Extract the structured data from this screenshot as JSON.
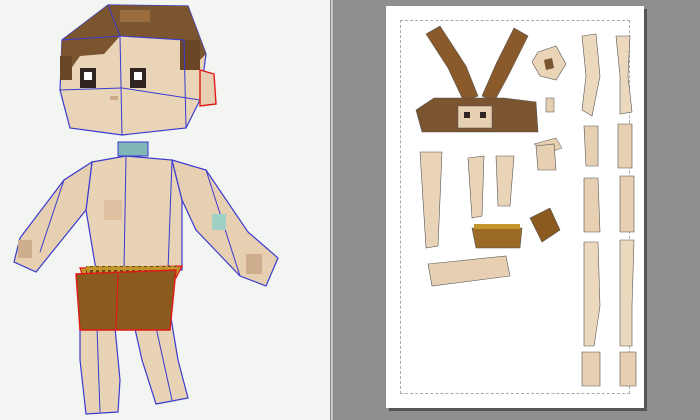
{
  "app": {
    "panes": {
      "left": "3d-model-view",
      "right": "unfolded-sheet-view"
    }
  },
  "colors": {
    "viewport_bg": "#f3f5f2",
    "sheet_area_bg": "#8e8e8e",
    "paper": "#ffffff",
    "skin": "#e7cfb2",
    "skin_shade": "#d8b998",
    "hair": "#7a5530",
    "hair_light": "#9a6c3e",
    "cloth": "#8a5a1e",
    "cloth_band": "#c2962c",
    "wire_blue": "#3a3ad0",
    "wire_red": "#e01818"
  },
  "icons": {
    "model": "paper-model-icon"
  }
}
